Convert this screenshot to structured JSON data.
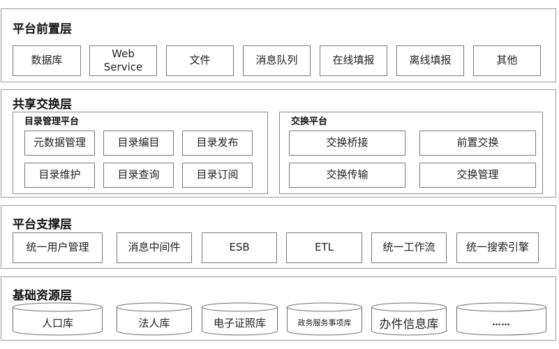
{
  "layers": {
    "frontend": {
      "title": "平台前置层",
      "items": [
        "数据库",
        "Web\nService",
        "文件",
        "消息队列",
        "在线填报",
        "离线填报",
        "其他"
      ]
    },
    "exchange": {
      "title": "共享交换层",
      "catalog": {
        "title": "目录管理平台",
        "items": [
          "元数据管理",
          "目录编目",
          "目录发布",
          "目录维护",
          "目录查询",
          "目录订阅"
        ]
      },
      "switch": {
        "title": "交换平台",
        "items": [
          "交换桥接",
          "前置交换",
          "交换传输",
          "交换管理"
        ]
      }
    },
    "support": {
      "title": "平台支撑层",
      "items": [
        "统一用户管理",
        "消息中间件",
        "ESB",
        "ETL",
        "统一工作流",
        "统一搜索引擎"
      ]
    },
    "resource": {
      "title": "基础资源层",
      "items": [
        "人口库",
        "法人库",
        "电子证照库",
        "政务服务事项库",
        "办件信息库",
        "……"
      ]
    }
  },
  "colors": {
    "border": "#9a9a9a",
    "box_border": "#7a7a7a",
    "text": "#222222"
  }
}
